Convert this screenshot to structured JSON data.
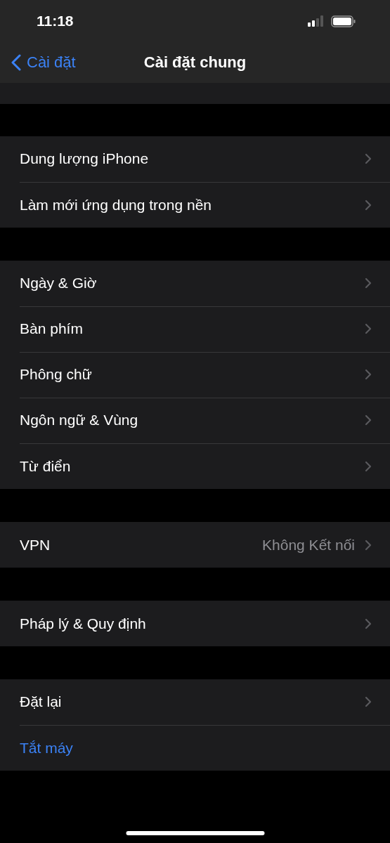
{
  "status_bar": {
    "time": "11:18"
  },
  "nav": {
    "back": "Cài đặt",
    "title": "Cài đặt chung"
  },
  "groups": [
    {
      "rows": [
        {
          "kind": "link",
          "label": "Dung lượng iPhone"
        },
        {
          "kind": "link",
          "label": "Làm mới ứng dụng trong nền"
        }
      ]
    },
    {
      "rows": [
        {
          "kind": "link",
          "label": "Ngày & Giờ"
        },
        {
          "kind": "link",
          "label": "Bàn phím"
        },
        {
          "kind": "link",
          "label": "Phông chữ"
        },
        {
          "kind": "link",
          "label": "Ngôn ngữ & Vùng"
        },
        {
          "kind": "link",
          "label": "Từ điển"
        }
      ]
    },
    {
      "rows": [
        {
          "kind": "link",
          "label": "VPN",
          "value": "Không Kết nối"
        }
      ]
    },
    {
      "rows": [
        {
          "kind": "link",
          "label": "Pháp lý & Quy định"
        }
      ]
    },
    {
      "rows": [
        {
          "kind": "link",
          "label": "Đặt lại"
        },
        {
          "kind": "action",
          "label": "Tắt máy"
        }
      ]
    }
  ]
}
